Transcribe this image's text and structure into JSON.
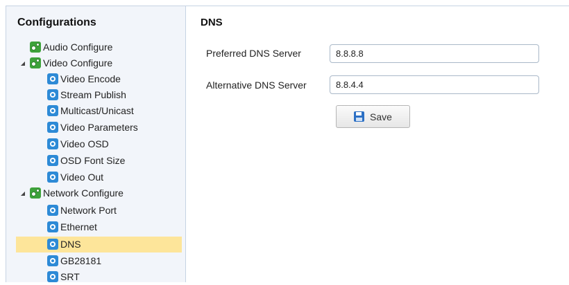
{
  "sidebar": {
    "title": "Configurations",
    "items": [
      {
        "label": "Audio Configure",
        "icon": "group-gear-icon",
        "level": 0,
        "expander": ""
      },
      {
        "label": "Video Configure",
        "icon": "group-gear-icon",
        "level": 0,
        "expander": "expanded"
      },
      {
        "label": "Video Encode",
        "icon": "gear-icon",
        "level": 1
      },
      {
        "label": "Stream Publish",
        "icon": "gear-icon",
        "level": 1
      },
      {
        "label": "Multicast/Unicast",
        "icon": "gear-icon",
        "level": 1
      },
      {
        "label": "Video Parameters",
        "icon": "gear-icon",
        "level": 1
      },
      {
        "label": "Video OSD",
        "icon": "gear-icon",
        "level": 1
      },
      {
        "label": "OSD Font Size",
        "icon": "gear-icon",
        "level": 1
      },
      {
        "label": "Video Out",
        "icon": "gear-icon",
        "level": 1
      },
      {
        "label": "Network Configure",
        "icon": "group-gear-icon",
        "level": 0,
        "expander": "expanded"
      },
      {
        "label": "Network Port",
        "icon": "gear-icon",
        "level": 1
      },
      {
        "label": "Ethernet",
        "icon": "gear-icon",
        "level": 1
      },
      {
        "label": "DNS",
        "icon": "gear-icon",
        "level": 1,
        "selected": true
      },
      {
        "label": "GB28181",
        "icon": "gear-icon",
        "level": 1
      },
      {
        "label": "SRT",
        "icon": "gear-icon",
        "level": 1
      }
    ],
    "selected_color": "#fde59a"
  },
  "main": {
    "title": "DNS",
    "preferred": {
      "label": "Preferred DNS Server",
      "value": "8.8.8.8"
    },
    "alternative": {
      "label": "Alternative DNS Server",
      "value": "8.8.4.4"
    },
    "save_label": "Save"
  },
  "colors": {
    "sidebar_bg": "#f2f5fa",
    "border": "#c6d3e3",
    "group_icon": "#3da23a",
    "gear_icon": "#2d8ad6"
  }
}
